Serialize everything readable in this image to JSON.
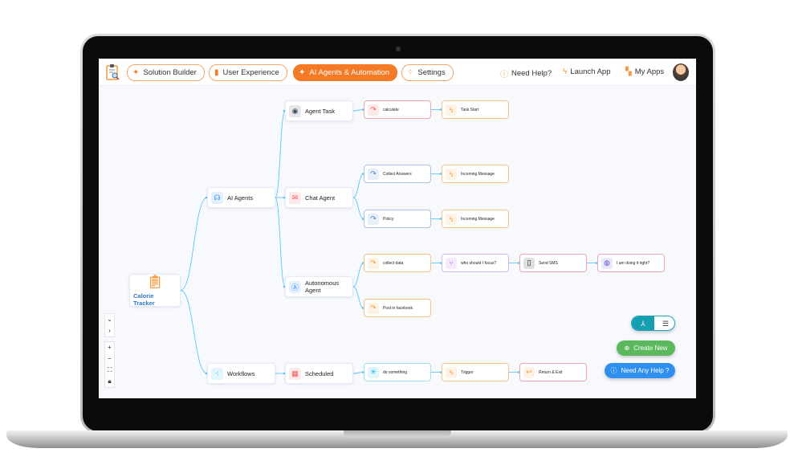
{
  "topbar": {
    "tabs": [
      {
        "label": "Solution Builder",
        "icon": "sparkle-icon",
        "active": false
      },
      {
        "label": "User Experience",
        "icon": "phone-icon",
        "active": false
      },
      {
        "label": "AI Agents & Automation",
        "icon": "sparkle-icon",
        "active": true
      },
      {
        "label": "Settings",
        "icon": "dots-icon",
        "active": false
      }
    ],
    "links": [
      {
        "label": "Need Help?",
        "icon": "question-icon"
      },
      {
        "label": "Launch App",
        "icon": "lightning-icon"
      },
      {
        "label": "My Apps",
        "icon": "grid-icon"
      }
    ]
  },
  "colors": {
    "accent": "#f47a25",
    "edge": "#5cc8f5",
    "create": "#5cb85c",
    "help": "#2f8ff0",
    "toggle": "#159fb1"
  },
  "canvas": {
    "nodes": [
      {
        "label": "Calorie Tracker",
        "icon": "clipboard-icon",
        "parent": null
      },
      {
        "label": "AI Agents",
        "icon": "brain-icon",
        "parent": 0,
        "color": "#2f8ff0"
      },
      {
        "label": "Workflows",
        "icon": "workflow-icon",
        "parent": 0,
        "color": "#19b5e6"
      },
      {
        "label": "Agent Task",
        "icon": "robot-icon",
        "parent": 1,
        "color": "#3a4a5a"
      },
      {
        "label": "Chat Agent",
        "icon": "chat-icon",
        "parent": 1,
        "color": "#f2575a"
      },
      {
        "label": "Autonomous Agent",
        "icon": "ai-shield-icon",
        "parent": 1,
        "color": "#2f8ff0"
      },
      {
        "label": "Scheduled",
        "icon": "calendar-icon",
        "parent": 2,
        "color": "#f2575a"
      },
      {
        "label": "calculate",
        "icon": "route-icon",
        "parent": 3,
        "color": "#f2575a",
        "border": "#f4a3a6"
      },
      {
        "label": "Task Start",
        "icon": "bolt-icon",
        "parent": 7,
        "color": "#f59a3c",
        "border": "#f8c283"
      },
      {
        "label": "Collect Answers",
        "icon": "route-icon",
        "parent": 4,
        "color": "#4a86d4",
        "border": "#a9c4ea"
      },
      {
        "label": "Incoming Message",
        "icon": "bolt-icon",
        "parent": 9,
        "color": "#f59a3c",
        "border": "#f8c283"
      },
      {
        "label": "Policy",
        "icon": "route-icon",
        "parent": 4,
        "color": "#4a86d4",
        "border": "#a9c4ea"
      },
      {
        "label": "Incoming Message",
        "icon": "bolt-icon",
        "parent": 11,
        "color": "#f59a3c",
        "border": "#f8c283"
      },
      {
        "label": "collect data",
        "icon": "route-icon",
        "parent": 5,
        "color": "#f59a3c",
        "border": "#f8c283"
      },
      {
        "label": "who should I focus?",
        "icon": "branch-icon",
        "parent": 13,
        "color": "#b36be6",
        "border": "#d6b3f2"
      },
      {
        "label": "Send SMS",
        "icon": "sms-phone-icon",
        "parent": 14,
        "color": "#111111",
        "border": "#f3a3b5"
      },
      {
        "label": "I am doing it right?",
        "icon": "ai-globe-icon",
        "parent": 15,
        "color": "#5a4fd8",
        "border": "#f3a3b5"
      },
      {
        "label": "Post in facebook",
        "icon": "route-icon",
        "parent": 5,
        "color": "#f59a3c",
        "border": "#f8c283"
      },
      {
        "label": "do something",
        "icon": "network-icon",
        "parent": 6,
        "color": "#19b5e6",
        "border": "#9fdff3"
      },
      {
        "label": "Trigger",
        "icon": "bolt-icon",
        "parent": 18,
        "color": "#f59a3c",
        "border": "#f8c283"
      },
      {
        "label": "Return & Exit",
        "icon": "return-icon",
        "parent": 19,
        "color": "#f59a3c",
        "border": "#f3a3b5"
      }
    ]
  },
  "controls": [
    "chevron-down-icon",
    "chevron-right-icon",
    "plus-icon",
    "minus-icon",
    "fit-view-icon",
    "lock-icon"
  ],
  "fabs": {
    "create_label": "Create New",
    "help_label": "Need Any Help ?",
    "view_toggle": [
      "tree-view",
      "list-view"
    ]
  }
}
